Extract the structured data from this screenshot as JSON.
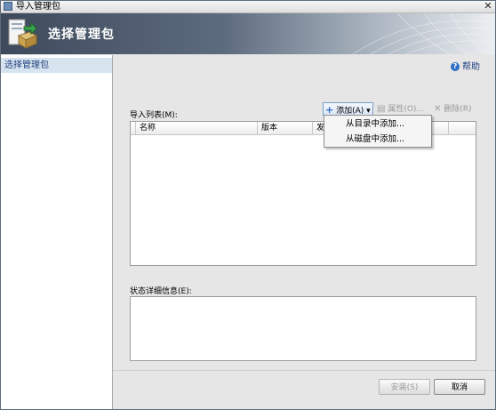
{
  "window": {
    "title": "导入管理包",
    "close_glyph": "✕"
  },
  "header": {
    "title": "选择管理包"
  },
  "sidebar": {
    "items": [
      {
        "label": "选择管理包"
      }
    ]
  },
  "help": {
    "label": "帮助",
    "icon": "help-icon"
  },
  "import_list": {
    "label": "导入列表(M):",
    "columns": [
      "名称",
      "版本",
      "发"
    ]
  },
  "toolbar": {
    "add_label": "添加(A)",
    "add_arrow": "▾",
    "properties_label": "属性(O)...",
    "delete_label": "删除(R)"
  },
  "add_menu": {
    "items": [
      "从目录中添加...",
      "从磁盘中添加..."
    ]
  },
  "status_details": {
    "label": "状态详细信息(E):"
  },
  "footer": {
    "install_label": "安装(S)",
    "cancel_label": "取消"
  },
  "colors": {
    "accent": "#1f3f80",
    "selection": "#d7e3ee",
    "header_dark": "#3e4a5c"
  }
}
